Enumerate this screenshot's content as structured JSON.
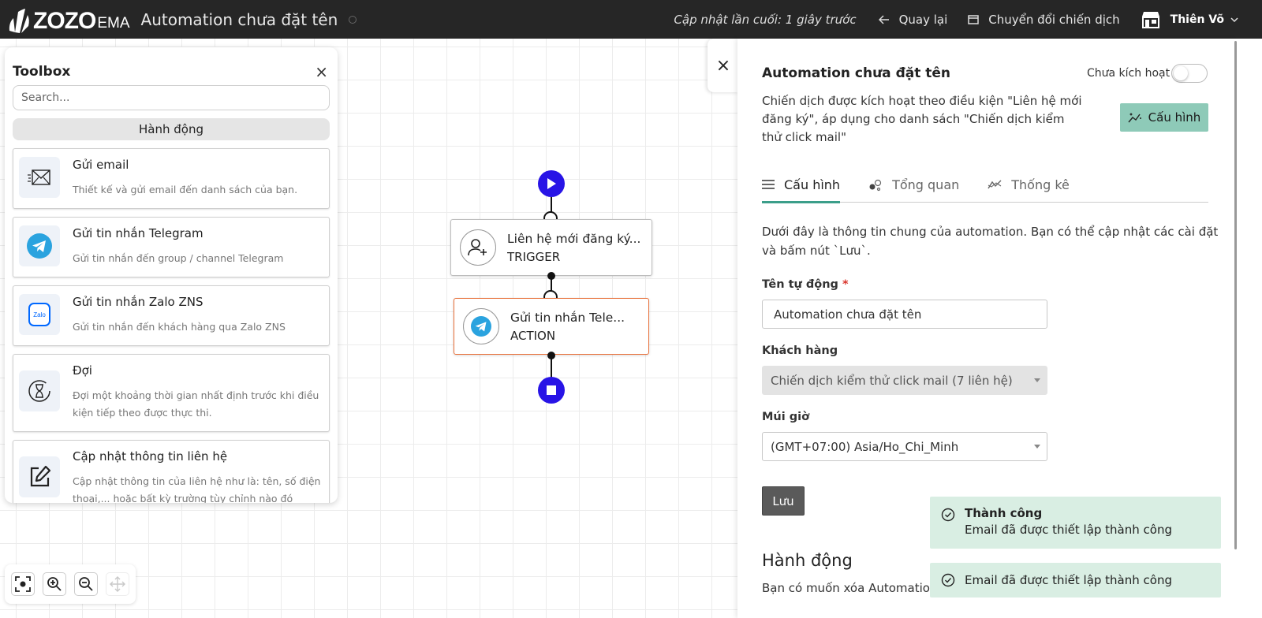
{
  "header": {
    "logo_text": "ZOZO",
    "logo_sub": "EMA",
    "title": "Automation chưa đặt tên",
    "last_updated": "Cập nhật lần cuối: 1 giây trước",
    "back_label": "Quay lại",
    "switch_label": "Chuyển đổi chiến dịch",
    "user_name": "Thiên Võ"
  },
  "toolbox": {
    "title": "Toolbox",
    "search_placeholder": "Search...",
    "section_label": "Hành động",
    "items": [
      {
        "name": "Gửi email",
        "desc": "Thiết kế và gửi email đến danh sách của bạn.",
        "icon": "email-icon"
      },
      {
        "name": "Gửi tin nhắn Telegram",
        "desc": "Gửi tin nhắn đến group / channel Telegram",
        "icon": "telegram-icon"
      },
      {
        "name": "Gửi tin nhắn Zalo ZNS",
        "desc": "Gửi tin nhắn đến khách hàng qua Zalo ZNS",
        "icon": "zalo-icon",
        "icon_text": "Zalo"
      },
      {
        "name": "Đợi",
        "desc": "Đợi một khoảng thời gian nhất định trước khi điều kiện tiếp theo được thực thi.",
        "icon": "hourglass-icon"
      },
      {
        "name": "Cập nhật thông tin liên hệ",
        "desc": "Cập nhật thông tin của liên hệ như là: tên, số điện thoại,... hoặc bất kỳ trường tùy chỉnh nào đó",
        "icon": "edit-icon"
      }
    ]
  },
  "flow": {
    "trigger": {
      "title": "Liên hệ mới đăng ký...",
      "type": "TRIGGER"
    },
    "action": {
      "title": "Gửi tin nhắn Tele...",
      "type": "ACTION"
    }
  },
  "panel": {
    "title": "Automation chưa đặt tên",
    "status": "Chưa kích hoạt",
    "description": "Chiến dịch được kích hoạt theo điều kiện \"Liên hệ mới đăng ký\", áp dụng cho danh sách \"Chiến dịch kiểm thử click mail\"",
    "config_button": "Cấu hình",
    "tabs": [
      {
        "label": "Cấu hình",
        "active": true
      },
      {
        "label": "Tổng quan",
        "active": false
      },
      {
        "label": "Thống kê",
        "active": false
      }
    ],
    "intro": "Dưới đây là thông tin chung của automation. Bạn có thể cập nhật các cài đặt và bấm nút `Lưu`.",
    "name_label": "Tên tự động",
    "name_required": "*",
    "name_value": "Automation chưa đặt tên",
    "customer_label": "Khách hàng",
    "customer_value": "Chiến dịch kiểm thử click mail (7 liên hệ)",
    "timezone_label": "Múi giờ",
    "timezone_value": "(GMT+07:00) Asia/Ho_Chi_Minh",
    "save_button": "Lưu",
    "action_heading": "Hành động",
    "action_text": "Bạn có muốn xóa Automation"
  },
  "toasts": [
    {
      "title": "Thành công",
      "message": "Email đã được thiết lập thành công"
    },
    {
      "title": "",
      "message": "Email đã được thiết lập thành công"
    }
  ],
  "colors": {
    "topbar": "#262626",
    "accent": "#3b9e8a",
    "config_button": "#8ecab8",
    "flow_node_circle": "#2814e6",
    "selected_border": "#e8703a",
    "toast_bg": "#d9eee3"
  }
}
